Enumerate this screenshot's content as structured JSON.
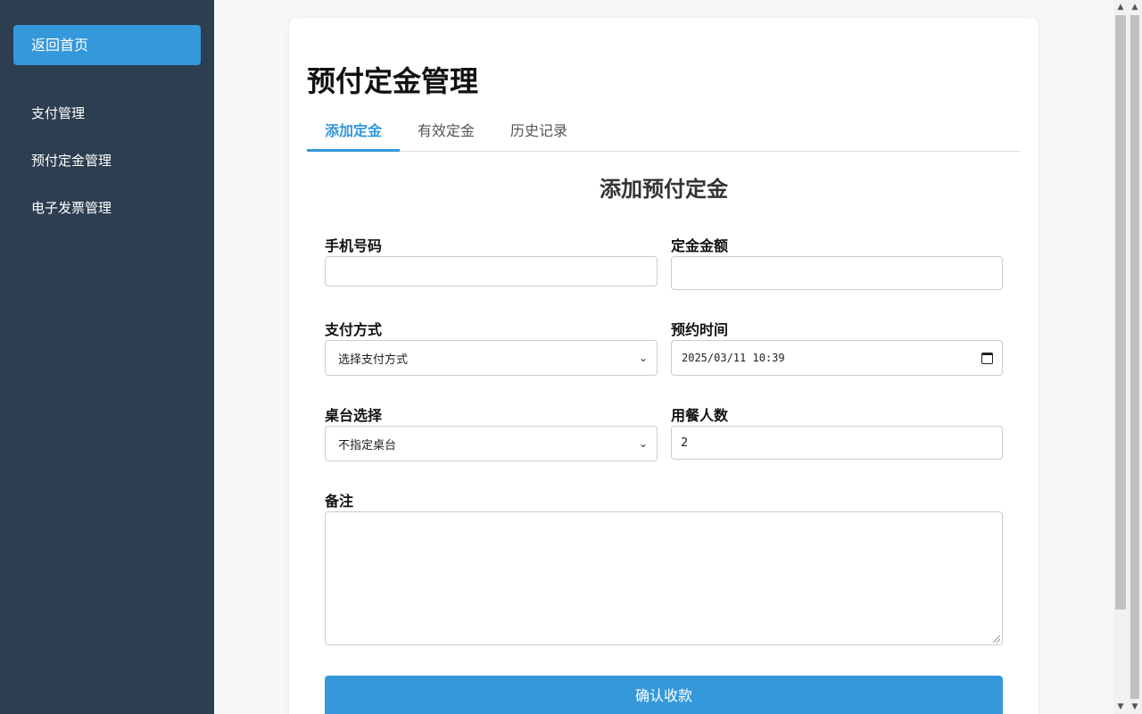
{
  "sidebar": {
    "home": "返回首页",
    "items": [
      "支付管理",
      "预付定金管理",
      "电子发票管理"
    ]
  },
  "page": {
    "title": "预付定金管理",
    "tabs": [
      "添加定金",
      "有效定金",
      "历史记录"
    ],
    "active_tab": "添加定金",
    "section_title": "添加预付定金"
  },
  "form": {
    "phone": {
      "label": "手机号码",
      "value": ""
    },
    "amount": {
      "label": "定金金额",
      "value": ""
    },
    "payment": {
      "label": "支付方式",
      "value": "选择支付方式"
    },
    "time": {
      "label": "预约时间",
      "value": "2025/03/11 10:39"
    },
    "table": {
      "label": "桌台选择",
      "value": "不指定桌台"
    },
    "guests": {
      "label": "用餐人数",
      "value": "2"
    },
    "note": {
      "label": "备注",
      "value": ""
    },
    "submit": "确认收款"
  },
  "colors": {
    "sidebar_bg": "#2c3e50",
    "accent": "#3498db"
  }
}
